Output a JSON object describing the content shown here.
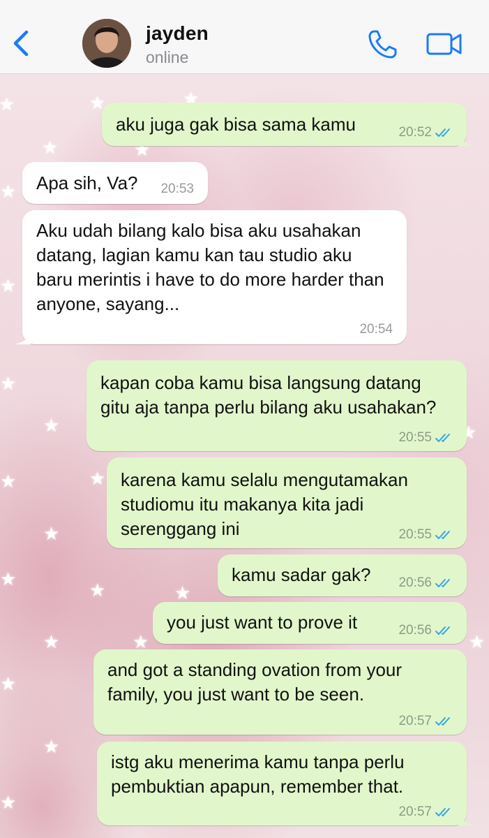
{
  "header": {
    "contact_name": "jayden",
    "status": "online"
  },
  "colors": {
    "accent": "#1a7cf5",
    "outgoing_bubble": "#e1f7cb",
    "incoming_bubble": "#ffffff",
    "read_ticks": "#34a6e6"
  },
  "icons": [
    "chevron-left-icon",
    "phone-icon",
    "video-camera-icon",
    "double-check-icon",
    "star-icon"
  ],
  "messages": [
    {
      "direction": "out",
      "text": "aku juga gak bisa sama kamu",
      "time": "20:52",
      "read": true
    },
    {
      "direction": "in",
      "text": "Apa sih, Va?",
      "time": "20:53"
    },
    {
      "direction": "in",
      "text": "Aku udah bilang kalo bisa aku usahakan datang, lagian kamu kan tau studio aku baru merintis i have to do more harder than anyone, sayang...",
      "time": "20:54"
    },
    {
      "direction": "out",
      "text": "kapan coba kamu bisa langsung datang gitu aja tanpa perlu bilang aku usahakan?",
      "time": "20:55",
      "read": true
    },
    {
      "direction": "out",
      "text": "karena kamu selalu mengutamakan studiomu itu makanya kita jadi serenggang ini",
      "time": "20:55",
      "read": true
    },
    {
      "direction": "out",
      "text": "kamu sadar gak?",
      "time": "20:56",
      "read": true
    },
    {
      "direction": "out",
      "text": "you just want to prove it",
      "time": "20:56",
      "read": true
    },
    {
      "direction": "out",
      "text": "and got a standing ovation from your family, you just want to be seen.",
      "time": "20:57",
      "read": true
    },
    {
      "direction": "out",
      "text": "istg aku menerima kamu tanpa perlu pembuktian apapun, remember that.",
      "time": "20:57",
      "read": true
    }
  ]
}
